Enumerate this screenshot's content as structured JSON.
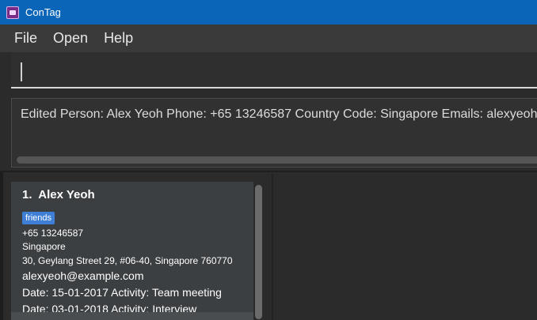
{
  "window": {
    "title": "ConTag"
  },
  "menu": {
    "items": [
      "File",
      "Open",
      "Help"
    ]
  },
  "command": {
    "value": ""
  },
  "result": {
    "text": "Edited Person: Alex Yeoh Phone: +65 13246587 Country Code: Singapore Emails: alexyeoh@example.com"
  },
  "persons": [
    {
      "index": "1.",
      "name": "Alex Yeoh",
      "tags": [
        "friends"
      ],
      "phone": "+65 13246587",
      "country": "Singapore",
      "address": "30, Geylang Street 29, #06-40, Singapore 760770",
      "email": "alexyeoh@example.com",
      "activities": [
        "Date: 15-01-2017 Activity: Team meeting",
        "Date: 03-01-2018 Activity: Interview"
      ]
    }
  ],
  "colors": {
    "titlebar": "#0a64b8",
    "background": "#2b2b2b",
    "card": "#3c3f41",
    "tag": "#3f7fd6"
  }
}
